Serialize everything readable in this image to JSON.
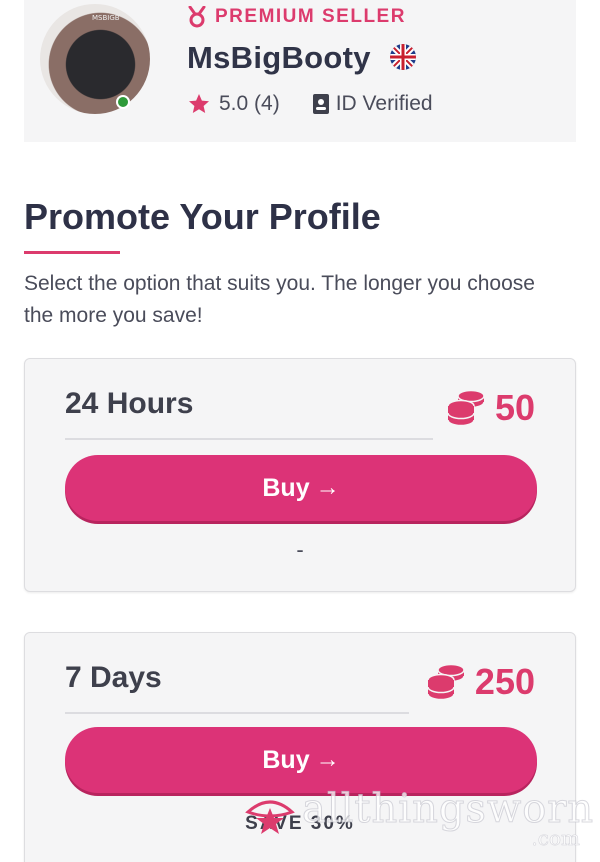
{
  "seller": {
    "badge": "PREMIUM SELLER",
    "name": "MsBigBooty",
    "avatar_tag": "MSBIGB",
    "rating": "5.0 (4)",
    "verified": "ID Verified"
  },
  "page": {
    "title": "Promote Your Profile",
    "subtitle": "Select the option that suits you. The longer you choose the more you save!"
  },
  "options": [
    {
      "label": "24 Hours",
      "price": "50",
      "button": "Buy",
      "note": "-"
    },
    {
      "label": "7 Days",
      "price": "250",
      "button": "Buy",
      "note": "SAVE 30%"
    }
  ],
  "watermark": {
    "text": "allthingsworn",
    "sub": ".com"
  },
  "colors": {
    "accent": "#dc3b6d",
    "button": "#dc3377",
    "online": "#2e9a3a",
    "card_bg": "#f5f5f6"
  },
  "icons": [
    "medal-icon",
    "uk-flag-icon",
    "star-icon",
    "id-badge-icon",
    "coins-icon",
    "arrow-right-icon"
  ]
}
